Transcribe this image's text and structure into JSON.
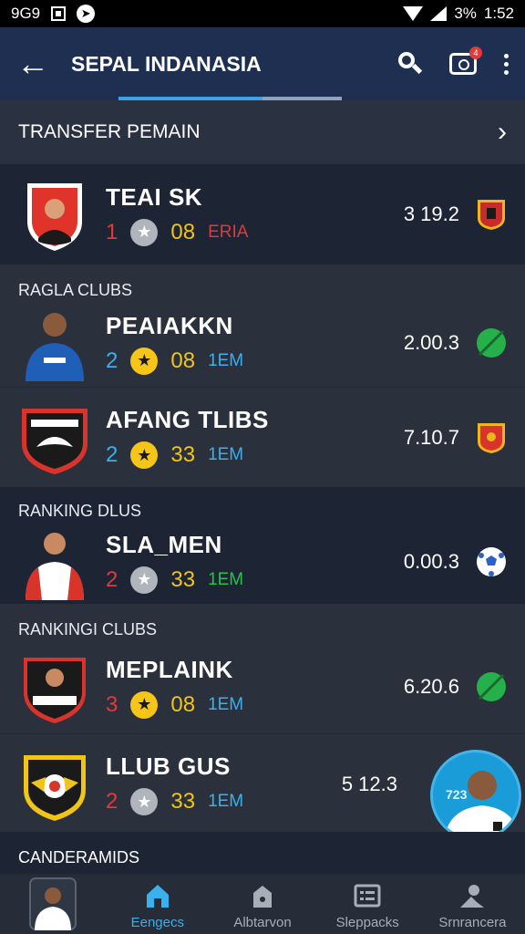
{
  "status_bar": {
    "left_text": "9G9",
    "battery": "3%",
    "time": "1:52"
  },
  "app_bar": {
    "title": "SEPAL INDANASIA",
    "notification_count": "4"
  },
  "section": {
    "title": "TRANSFER PEMAIN"
  },
  "rows": [
    {
      "group_label": "",
      "name": "TEAI SK",
      "num": "1",
      "num_color": "#e03a3a",
      "star": "gray",
      "sub": "08",
      "tag": "ERIA",
      "tag_color": "#e03a3a",
      "score": "3 19.2",
      "badge_icon": "club-crest-icon",
      "badge_color": "#c82b2b"
    },
    {
      "group_label": "RAGLA CLUBS",
      "name": "PEAIAKKN",
      "num": "2",
      "num_color": "#3ab0ec",
      "star": "gold",
      "sub": "08",
      "tag": "1EM",
      "tag_color": "#3ab0ec",
      "score": "2.00.3",
      "badge_icon": "green-ball-icon",
      "badge_color": "#26b04c"
    },
    {
      "group_label": "",
      "name": "AFANG TLIBS",
      "num": "2",
      "num_color": "#3ab0ec",
      "star": "gold",
      "sub": "33",
      "tag": "1EM",
      "tag_color": "#3ab0ec",
      "score": "7.10.7",
      "badge_icon": "club-crest-icon",
      "badge_color": "#d9342b"
    },
    {
      "group_label": "RANKING DLUS",
      "name": "SLA_MEN",
      "num": "2",
      "num_color": "#e03a3a",
      "star": "gray",
      "sub": "33",
      "tag": "1EM",
      "tag_color": "#26c24c",
      "score": "0.00.3",
      "badge_icon": "soccer-ball-icon",
      "badge_color": "#2a62c8"
    },
    {
      "group_label": "RANKINGI CLUBS",
      "name": "MEPLAINK",
      "num": "3",
      "num_color": "#e03a3a",
      "star": "gold",
      "sub": "08",
      "tag": "1EM",
      "tag_color": "#3ab0ec",
      "score": "6.20.6",
      "badge_icon": "green-ball-icon",
      "badge_color": "#26b04c"
    },
    {
      "group_label": "",
      "name": "LLUB GUS",
      "num": "2",
      "num_color": "#e03a3a",
      "star": "gray",
      "sub": "33",
      "tag": "1EM",
      "tag_color": "#3ab0ec",
      "score": "5 12.3",
      "badge_icon": "",
      "badge_color": ""
    }
  ],
  "fab": {
    "label": "723"
  },
  "bottom_section": {
    "title": "CANDERAMIDS"
  },
  "nav": {
    "items": [
      {
        "label": "",
        "icon": "player-avatar-icon"
      },
      {
        "label": "Eengecs",
        "icon": "home-icon"
      },
      {
        "label": "Albtarvon",
        "icon": "bag-icon"
      },
      {
        "label": "Sleppacks",
        "icon": "list-icon"
      },
      {
        "label": "Srnrancera",
        "icon": "profile-icon"
      }
    ],
    "active_index": 1
  },
  "colors": {
    "accent": "#3ab0ec",
    "gold": "#f5c518",
    "red": "#e03a3a",
    "app_bar": "#1e2f52"
  }
}
